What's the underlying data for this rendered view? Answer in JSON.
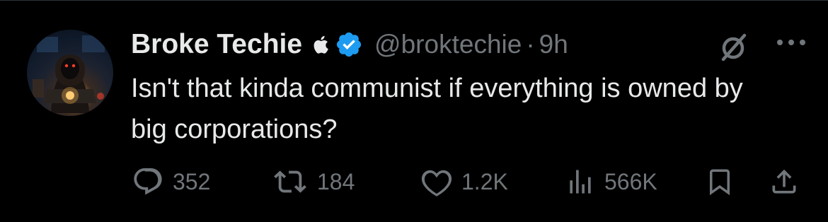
{
  "tweet": {
    "author": {
      "display_name": "Broke Techie",
      "handle": "@broktechie",
      "badges": [
        "apple-icon",
        "verified-icon"
      ],
      "verified_color": "#1d9bf0"
    },
    "separator": "·",
    "timestamp": "9h",
    "text": "Isn't that kinda communist if everything is owned by big corporations?",
    "actions": {
      "replies": "352",
      "retweets": "184",
      "likes": "1.2K",
      "views": "566K"
    }
  },
  "colors": {
    "background": "#000000",
    "primary_text": "#e7e9ea",
    "secondary_text": "#71767b",
    "accent": "#1d9bf0"
  }
}
